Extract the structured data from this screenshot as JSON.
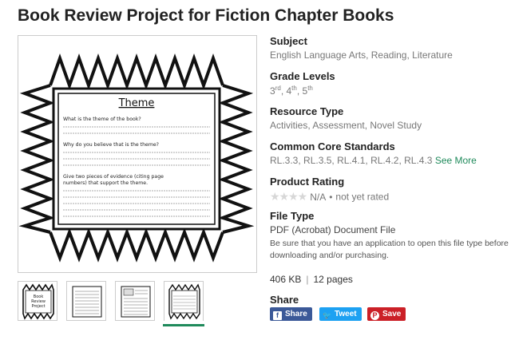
{
  "title": "Book Review Project for Fiction Chapter Books",
  "preview": {
    "worksheet_heading": "Theme",
    "prompts": [
      "What is the theme of the book?",
      "Why do you believe that is the theme?",
      "Give two pieces of evidence (citing page numbers) that support the theme."
    ]
  },
  "thumbnails": [
    {
      "label": "Book Review Project",
      "active": false
    },
    {
      "label": "",
      "active": false
    },
    {
      "label": "",
      "active": false
    },
    {
      "label": "",
      "active": true
    }
  ],
  "details": {
    "subject": {
      "label": "Subject",
      "values": [
        "English Language Arts",
        "Reading",
        "Literature"
      ]
    },
    "grade_levels": {
      "label": "Grade Levels",
      "values": [
        {
          "num": "3",
          "suffix": "rd"
        },
        {
          "num": "4",
          "suffix": "th"
        },
        {
          "num": "5",
          "suffix": "th"
        }
      ]
    },
    "resource_type": {
      "label": "Resource Type",
      "values": [
        "Activities",
        "Assessment",
        "Novel Study"
      ]
    },
    "standards": {
      "label": "Common Core Standards",
      "values": [
        "RL.3.3",
        "RL.3.5",
        "RL.4.1",
        "RL.4.2",
        "RL.4.3"
      ],
      "see_more": "See More"
    },
    "rating": {
      "label": "Product Rating",
      "stars": "★★★★",
      "na": "N/A",
      "dot": "•",
      "note": "not yet rated"
    },
    "file_type": {
      "label": "File Type",
      "value": "PDF (Acrobat) Document File",
      "note": "Be sure that you have an application to open this file type before downloading and/or purchasing."
    },
    "size": "406 KB",
    "size_sep": "|",
    "pages": "12 pages",
    "share": {
      "label": "Share",
      "facebook": "Share",
      "twitter": "Tweet",
      "pinterest": "Save"
    }
  },
  "colors": {
    "accent": "#1f8a5b",
    "facebook": "#3b5998",
    "twitter": "#1da1f2",
    "pinterest": "#cb2027"
  }
}
